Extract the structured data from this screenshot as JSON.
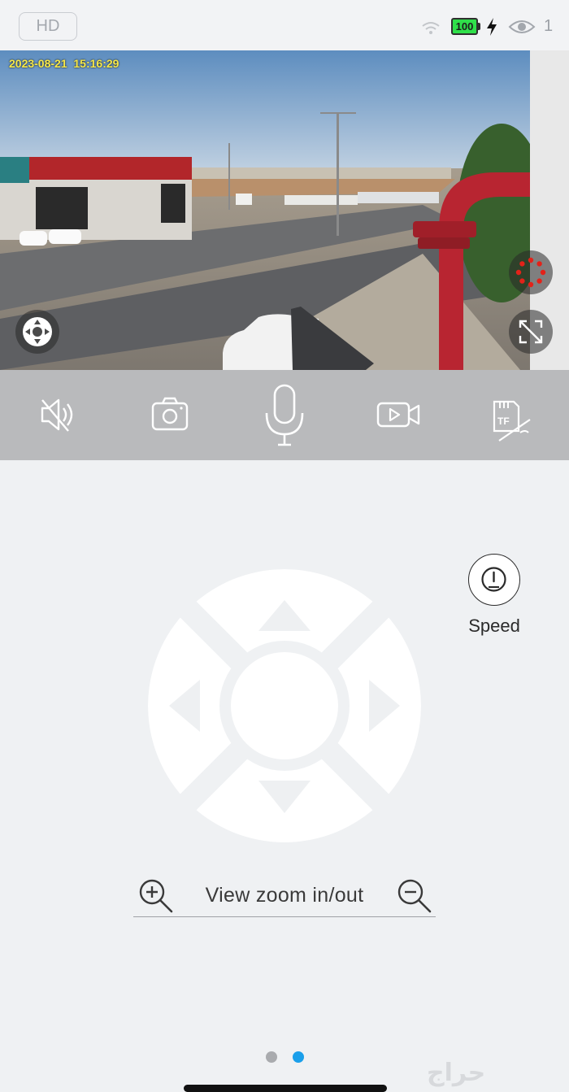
{
  "top_bar": {
    "quality_label": "HD",
    "battery_level": "100",
    "viewer_count": "1"
  },
  "video": {
    "timestamp": "2023-08-21  15:16:29"
  },
  "controls": {
    "mute_icon": "speaker-muted-icon",
    "snapshot_icon": "camera-icon",
    "talk_icon": "microphone-icon",
    "record_icon": "video-record-icon",
    "tf_icon": "tf-card-icon",
    "tf_card_label": "TF"
  },
  "ptz": {
    "speed_label": "Speed",
    "zoom_label": "View zoom in/out"
  },
  "pager": {
    "page_count": 2,
    "active_page": 2,
    "inactive_color": "#a9abae",
    "active_color": "#1a9fea"
  },
  "watermark": "حراج"
}
